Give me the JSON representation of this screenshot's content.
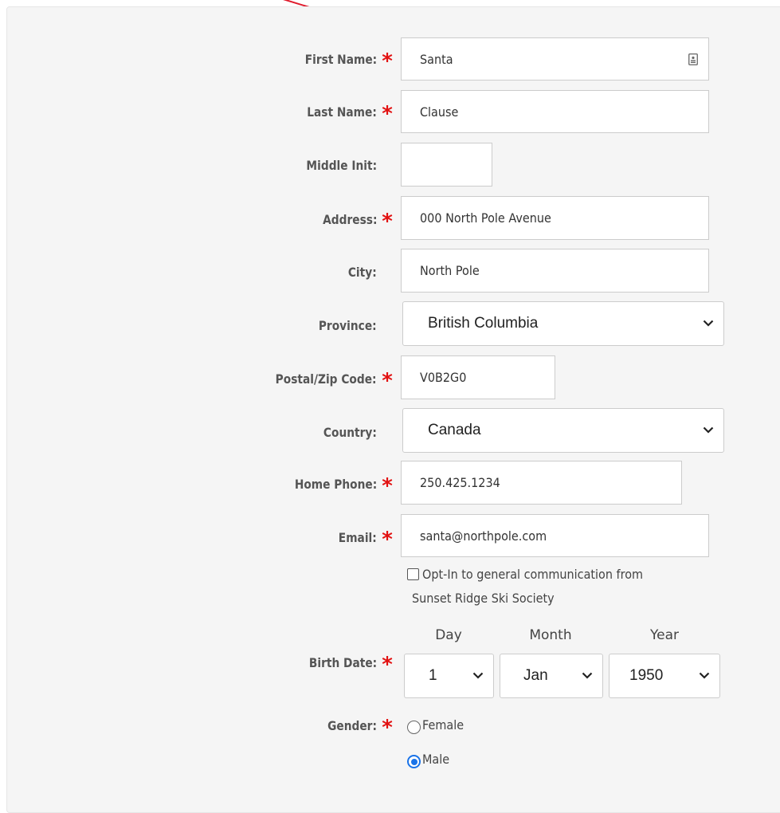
{
  "colors": {
    "required_star": "#e21212",
    "annotation_arrow": "#e01b2c",
    "radio_selected": "#1a73e8",
    "panel_bg": "#f5f5f5"
  },
  "required_marker": "*",
  "fields": {
    "first_name": {
      "label": "First Name:",
      "value": "Santa",
      "icon": "contact-card-icon"
    },
    "last_name": {
      "label": "Last Name:",
      "value": "Clause"
    },
    "middle_init": {
      "label": "Middle Init:",
      "value": ""
    },
    "address": {
      "label": "Address:",
      "value": "000 North Pole Avenue"
    },
    "city": {
      "label": "City:",
      "value": "North Pole"
    },
    "province": {
      "label": "Province:",
      "value": "British Columbia"
    },
    "postal": {
      "label": "Postal/Zip Code:",
      "value": "V0B2G0"
    },
    "country": {
      "label": "Country:",
      "value": "Canada"
    },
    "home_phone": {
      "label": "Home Phone:",
      "value": "250.425.1234"
    },
    "email": {
      "label": "Email:",
      "value": "santa@northpole.com"
    }
  },
  "opt_in": {
    "checked": false,
    "line1": "Opt-In to general communication from",
    "line2": "Sunset Ridge Ski Society"
  },
  "birth_date": {
    "label": "Birth Date:",
    "day": {
      "header": "Day",
      "value": "1"
    },
    "month": {
      "header": "Month",
      "value": "Jan"
    },
    "year": {
      "header": "Year",
      "value": "1950"
    }
  },
  "gender": {
    "label": "Gender:",
    "options": [
      {
        "label": "Female",
        "checked": false
      },
      {
        "label": "Male",
        "checked": true
      }
    ]
  }
}
